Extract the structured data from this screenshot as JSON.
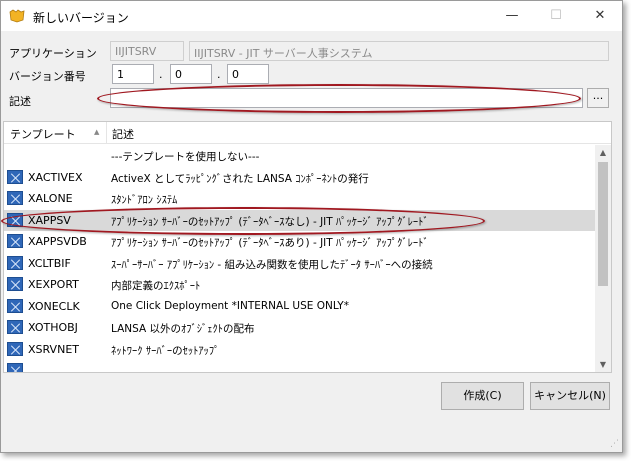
{
  "window": {
    "title": "新しいバージョン",
    "minimize_glyph": "—",
    "maximize_glyph": "☐",
    "close_glyph": "✕"
  },
  "form": {
    "application_label": "アプリケーション",
    "application_code": "IIJITSRV",
    "application_name": "IIJITSRV - JIT サーバー人事システム",
    "version_label": "バージョン番号",
    "version_major": "1",
    "version_minor": "0",
    "version_patch": "0",
    "version_separator": ".",
    "description_label": "記述",
    "description_value": "",
    "browse_button_label": "..."
  },
  "list": {
    "columns": [
      "テンプレート",
      "記述"
    ],
    "sort_indicator": "▲",
    "rows": [
      {
        "name": "",
        "description": "---テンプレートを使用しない---",
        "icon": ""
      },
      {
        "name": "XACTIVEX",
        "description": "ActiveX としてﾗｯﾋﾟﾝｸﾞされた LANSA ｺﾝﾎﾟｰﾈﾝﾄの発行",
        "icon": "template-icon"
      },
      {
        "name": "XALONE",
        "description": "ｽﾀﾝﾄﾞｱﾛﾝ ｼｽﾃﾑ",
        "icon": "template-icon"
      },
      {
        "name": "XAPPSV",
        "description": "ｱﾌﾟﾘｹｰｼｮﾝ ｻｰﾊﾞｰのｾｯﾄｱｯﾌﾟ (ﾃﾞｰﾀﾍﾞｰｽなし) - JIT ﾊﾟｯｹｰｼﾞ ｱｯﾌﾟｸﾞﾚｰﾄﾞ",
        "icon": "template-icon"
      },
      {
        "name": "XAPPSVDB",
        "description": "ｱﾌﾟﾘｹｰｼｮﾝ ｻｰﾊﾞｰのｾｯﾄｱｯﾌﾟ (ﾃﾞｰﾀﾍﾞｰｽあり) - JIT ﾊﾟｯｹｰｼﾞ ｱｯﾌﾟｸﾞﾚｰﾄﾞ",
        "icon": "template-icon"
      },
      {
        "name": "XCLTBIF",
        "description": "ｽｰﾊﾟｰｻｰﾊﾞｰ ｱﾌﾟﾘｹｰｼｮﾝ - 組み込み関数を使用したﾃﾞｰﾀ ｻｰﾊﾞｰへの接続",
        "icon": "template-icon"
      },
      {
        "name": "XEXPORT",
        "description": "内部定義のｴｸｽﾎﾟｰﾄ",
        "icon": "template-icon"
      },
      {
        "name": "XONECLK",
        "description": "One Click Deployment *INTERNAL USE ONLY*",
        "icon": "template-icon"
      },
      {
        "name": "XOTHOBJ",
        "description": "LANSA 以外のｵﾌﾞｼﾞｪｸﾄの配布",
        "icon": "template-icon"
      },
      {
        "name": "XSRVNET",
        "description": "ﾈｯﾄﾜｰｸ ｻｰﾊﾞｰのｾｯﾄｱｯﾌﾟ",
        "icon": "template-icon"
      },
      {
        "name": "",
        "description": "",
        "icon": "template-icon"
      }
    ],
    "selected_row": "XAPPSV",
    "scroll_up_glyph": "▲",
    "scroll_down_glyph": "▼"
  },
  "buttons": {
    "create_label": "作成(C)",
    "cancel_label": "キャンセル(N)"
  },
  "colors": {
    "highlight_outline": "#a01820",
    "selected_row": "#d9d9d9",
    "icon_blue": "#2f67b8"
  }
}
